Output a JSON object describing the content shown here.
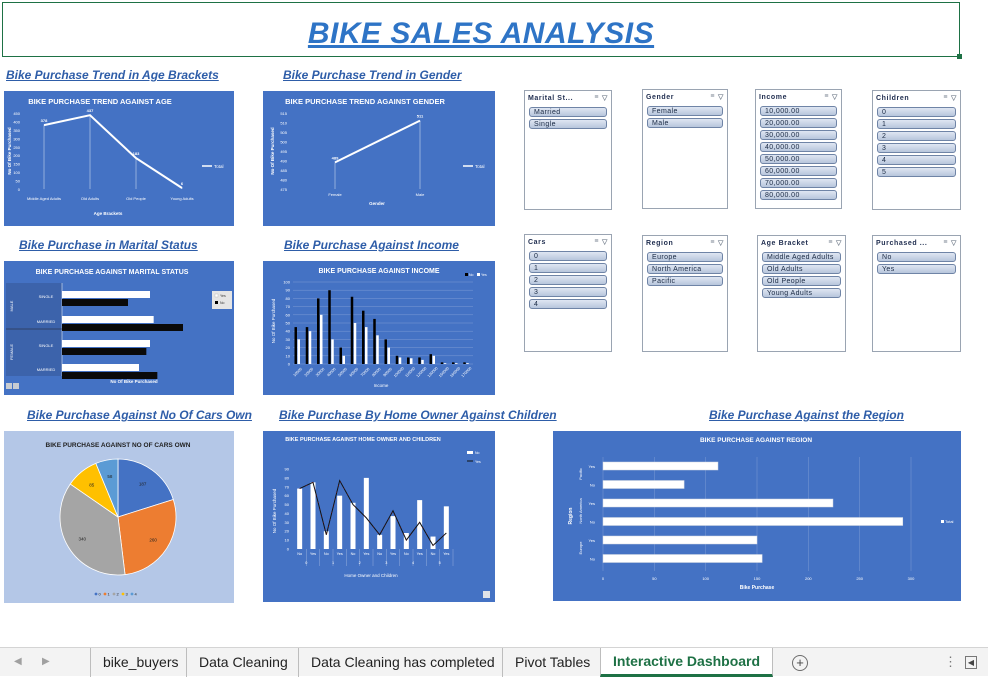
{
  "title": "BIKE SALES ANALYSIS",
  "sections": {
    "age": "Bike Purchase Trend in Age Brackets",
    "gender": "Bike Purchase Trend in Gender",
    "marital": "Bike Purchase in Marital Status",
    "income": "Bike Purchase Against Income",
    "cars": "Bike Purchase Against No Of Cars Own",
    "home": "Bike Purchase By Home Owner Against Children",
    "region": "Bike Purchase Against the Region"
  },
  "slicers": [
    {
      "header": "Marital St...",
      "items": [
        "Married",
        "Single"
      ]
    },
    {
      "header": "Gender",
      "items": [
        "Female",
        "Male"
      ]
    },
    {
      "header": "Income",
      "items": [
        "10,000.00",
        "20,000.00",
        "30,000.00",
        "40,000.00",
        "50,000.00",
        "60,000.00",
        "70,000.00",
        "80,000.00"
      ]
    },
    {
      "header": "Children",
      "items": [
        "0",
        "1",
        "2",
        "3",
        "4",
        "5"
      ]
    },
    {
      "header": "Cars",
      "items": [
        "0",
        "1",
        "2",
        "3",
        "4"
      ]
    },
    {
      "header": "Region",
      "items": [
        "Europe",
        "North America",
        "Pacific"
      ]
    },
    {
      "header": "Age Bracket",
      "items": [
        "Middle Aged Adults",
        "Old Adults",
        "Old People",
        "Young Adults"
      ]
    },
    {
      "header": "Purchased ...",
      "items": [
        "No",
        "Yes"
      ]
    }
  ],
  "chart_data": [
    {
      "id": "age",
      "type": "line",
      "title": "BIKE PURCHASE TREND AGAINST AGE",
      "xlabel": "Age Brackets",
      "ylabel": "No Of Bike Purchased",
      "categories": [
        "Middle Aged Adults",
        "Old Adults",
        "Old People",
        "Young Adults"
      ],
      "values": [
        378,
        437,
        183,
        6
      ],
      "y_ticks": [
        "0",
        "50",
        "100",
        "150",
        "200",
        "250",
        "300",
        "350",
        "400",
        "450"
      ],
      "ylim": [
        0,
        450
      ],
      "legend": [
        "Total"
      ],
      "legend_position": "right"
    },
    {
      "id": "gender",
      "type": "line",
      "title": "BIKE PURCHASE TREND AGAINST GENDER",
      "xlabel": "Gender",
      "ylabel": "No Of Bike Purchased",
      "categories": [
        "Female",
        "Male"
      ],
      "values": [
        489,
        511
      ],
      "y_ticks": [
        "475",
        "480",
        "485",
        "490",
        "495",
        "500",
        "505",
        "510",
        "515"
      ],
      "ylim": [
        475,
        515
      ],
      "legend": [
        "Total"
      ],
      "legend_position": "right"
    },
    {
      "id": "marital",
      "type": "bar",
      "title": "BIKE PURCHASE AGAINST MARITAL STATUS",
      "xlabel": "No Of Bike Purchased",
      "groups": [
        "MALE",
        "FEMALE"
      ],
      "categories": [
        "SINGLE",
        "MARRIED",
        "SINGLE",
        "MARRIED"
      ],
      "series": [
        {
          "name": "Yes",
          "values": [
            120,
            125,
            120,
            105
          ]
        },
        {
          "name": "No",
          "values": [
            90,
            165,
            115,
            130
          ]
        }
      ],
      "legend_position": "right"
    },
    {
      "id": "income",
      "type": "bar",
      "title": "BIKE PURCHASE AGAINST INCOME",
      "xlabel": "Income",
      "ylabel": "No Of Bike Purchased",
      "categories": [
        "10000",
        "20000",
        "30000",
        "40000",
        "50000",
        "60000",
        "70000",
        "80000",
        "90000",
        "100000",
        "110000",
        "120000",
        "130000",
        "150000",
        "160000",
        "170000"
      ],
      "series": [
        {
          "name": "No",
          "values": [
            45,
            45,
            80,
            90,
            20,
            82,
            65,
            55,
            30,
            10,
            8,
            8,
            12,
            2,
            2,
            2
          ]
        },
        {
          "name": "Yes",
          "values": [
            30,
            40,
            60,
            30,
            10,
            50,
            45,
            35,
            20,
            8,
            7,
            5,
            10,
            1,
            1,
            1
          ]
        }
      ],
      "y_ticks": [
        "0",
        "10",
        "20",
        "30",
        "40",
        "50",
        "60",
        "70",
        "80",
        "90",
        "100"
      ],
      "ylim": [
        0,
        100
      ],
      "legend_position": "top-right"
    },
    {
      "id": "cars",
      "type": "pie",
      "title": "BIKE PURCHASE AGAINST NO OF CARS OWN",
      "categories": [
        "0",
        "1",
        "2",
        "3",
        "4"
      ],
      "values": [
        187,
        260,
        340,
        85,
        58
      ],
      "colors": [
        "#4472c4",
        "#ed7d31",
        "#a5a5a5",
        "#ffc000",
        "#5b9bd5"
      ],
      "labels": [
        "187",
        "260",
        "340",
        "85",
        "58"
      ],
      "legend_position": "bottom"
    },
    {
      "id": "home",
      "type": "bar",
      "title": "BIKE PURCHASE AGAINST HOME OWNER AND CHILDREN",
      "xlabel": "Home Owner and Children",
      "ylabel": "No Of Bike Purchased",
      "groups": [
        "0",
        "1",
        "2",
        "3",
        "4",
        "5"
      ],
      "categories": [
        "No",
        "Yes",
        "No",
        "Yes",
        "No",
        "Yes",
        "No",
        "Yes",
        "No",
        "Yes",
        "No",
        "Yes"
      ],
      "series": [
        {
          "name": "No",
          "values": [
            68,
            75,
            20,
            60,
            52,
            80,
            16,
            37,
            18,
            55,
            14,
            48
          ]
        },
        {
          "name": "Yes",
          "values": [
            68,
            75,
            16,
            77,
            50,
            35,
            16,
            43,
            10,
            30,
            4,
            18
          ]
        }
      ],
      "y_ticks": [
        "0",
        "10",
        "20",
        "30",
        "40",
        "50",
        "60",
        "70",
        "80",
        "90"
      ],
      "ylim": [
        0,
        90
      ],
      "legend_position": "top-right"
    },
    {
      "id": "region",
      "type": "bar",
      "title": "BIKE PURCHASE AGAINST REGION",
      "xlabel": "Bike Purchase",
      "ylabel": "Region",
      "groups": [
        "Pacific",
        "North America",
        "Europe"
      ],
      "categories": [
        "Yes",
        "No",
        "Yes",
        "No",
        "Yes",
        "No"
      ],
      "values": [
        112,
        79,
        224,
        292,
        150,
        155
      ],
      "x_ticks": [
        "0",
        "50",
        "100",
        "150",
        "200",
        "250",
        "300"
      ],
      "xlim": [
        0,
        300
      ],
      "legend": [
        "Total"
      ],
      "legend_position": "right"
    }
  ],
  "tabs": {
    "sheets": [
      "bike_buyers",
      "Data Cleaning",
      "Data Cleaning has completed",
      "Pivot Tables",
      "Interactive Dashboard"
    ],
    "active": "Interactive Dashboard"
  }
}
